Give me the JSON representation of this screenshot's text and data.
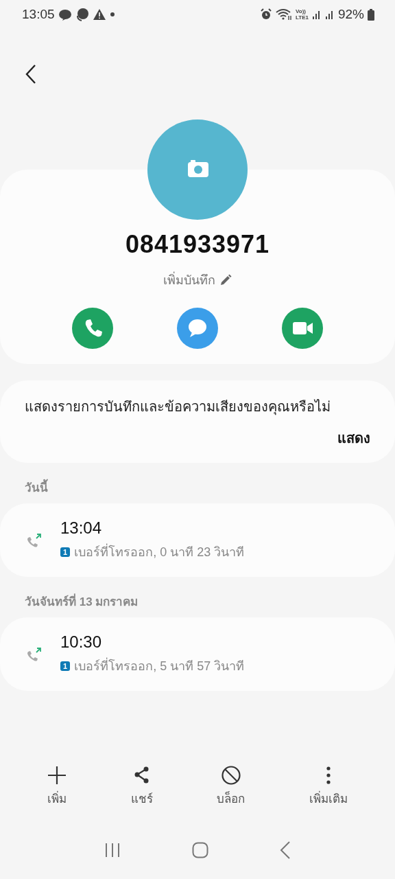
{
  "status_bar": {
    "time": "13:05",
    "network_top": "Vo))",
    "network_bottom": "LTE1",
    "battery": "92%"
  },
  "contact": {
    "number": "0841933971",
    "note_placeholder": "เพิ่มบันทึก",
    "actions": [
      {
        "kind": "call"
      },
      {
        "kind": "message"
      },
      {
        "kind": "video"
      }
    ]
  },
  "notice": {
    "text": "แสดงรายการบันทึกและข้อความเสียงของคุณหรือไม่",
    "action": "แสดง"
  },
  "sections": [
    {
      "heading": "วันนี้",
      "calls": [
        {
          "kind": "outgoing",
          "time": "13:04",
          "sim": "1",
          "detail": "เบอร์ที่โทรออก, 0 นาที 23 วินาที"
        }
      ]
    },
    {
      "heading": "วันจันทร์ที่ 13 มกราคม",
      "calls": [
        {
          "kind": "outgoing",
          "time": "10:30",
          "sim": "1",
          "detail": "เบอร์ที่โทรออก, 5 นาที 57 วินาที"
        }
      ]
    }
  ],
  "toolbar": [
    {
      "kind": "add",
      "label": "เพิ่ม"
    },
    {
      "kind": "share",
      "label": "แชร์"
    },
    {
      "kind": "block",
      "label": "บล็อก"
    },
    {
      "kind": "more",
      "label": "เพิ่มเติม"
    }
  ]
}
